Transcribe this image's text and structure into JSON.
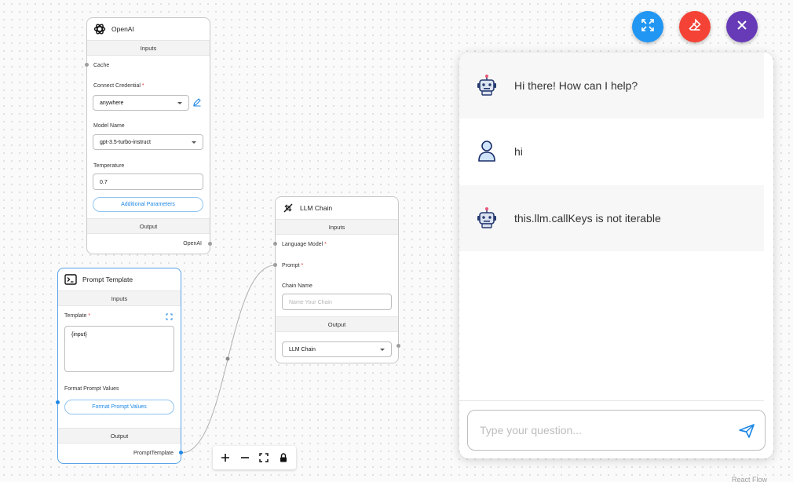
{
  "openai_node": {
    "title": "OpenAI",
    "inputs_label": "Inputs",
    "cache_label": "Cache",
    "credential_label": "Connect Credential",
    "credential_value": "anywhere",
    "model_label": "Model Name",
    "model_value": "gpt-3.5-turbo-instruct",
    "temperature_label": "Temperature",
    "temperature_value": "0.7",
    "additional_params_label": "Additional Parameters",
    "output_label": "Output",
    "output_port_label": "OpenAI"
  },
  "prompt_node": {
    "title": "Prompt Template",
    "inputs_label": "Inputs",
    "template_label": "Template",
    "template_value": "{input}",
    "format_label": "Format Prompt Values",
    "format_button_label": "Format Prompt Values",
    "output_label": "Output",
    "output_port_label": "PromptTemplate"
  },
  "llm_chain_node": {
    "title": "LLM Chain",
    "inputs_label": "Inputs",
    "language_model_label": "Language Model",
    "prompt_label": "Prompt",
    "chain_name_label": "Chain Name",
    "chain_name_placeholder": "Name Your Chain",
    "output_label": "Output",
    "output_value": "LLM Chain"
  },
  "required_mark": "*",
  "chat": {
    "messages": [
      {
        "role": "bot",
        "text": "Hi there! How can I help?"
      },
      {
        "role": "user",
        "text": "hi"
      },
      {
        "role": "bot",
        "text": "this.llm.callKeys is not iterable"
      }
    ],
    "input_placeholder": "Type your question..."
  },
  "footer": {
    "attribution": "React Flow"
  },
  "colors": {
    "expand_fab": "#2196f3",
    "clear_fab": "#f44336",
    "close_fab": "#673ab7",
    "accent_blue": "#1e88e5",
    "required_red": "#e53935"
  },
  "icons": {
    "openai": "openai-logo-icon",
    "prompt": "terminal-icon",
    "llm_chain": "chain-link-icon",
    "expand": "expand-icon",
    "clear": "eraser-icon",
    "close": "close-icon",
    "bot": "robot-icon",
    "user": "person-icon",
    "send": "send-icon",
    "edit": "edit-icon",
    "zoom_in": "plus-icon",
    "zoom_out": "minus-icon",
    "fit_view": "fit-view-icon",
    "lock": "lock-icon"
  }
}
